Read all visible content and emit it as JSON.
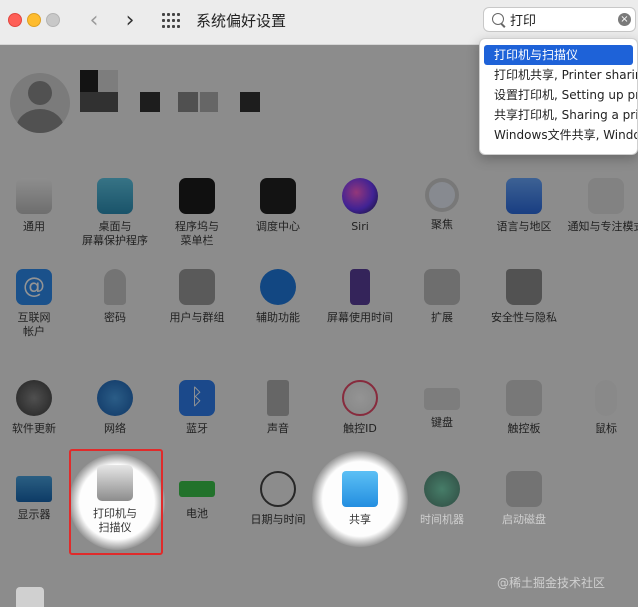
{
  "window": {
    "title": "系统偏好设置"
  },
  "search": {
    "value": "打印"
  },
  "dropdown": {
    "items": [
      "打印机与扫描仪",
      "打印机共享, Printer sharing",
      "设置打印机, Setting up printers",
      "共享打印机, Sharing a printer",
      "Windows文件共享, Windows file sharing"
    ]
  },
  "prefs": {
    "row1": [
      {
        "label": "通用"
      },
      {
        "label": "桌面与\n屏幕保护程序"
      },
      {
        "label": "程序坞与\n菜单栏"
      },
      {
        "label": "调度中心"
      },
      {
        "label": "Siri"
      },
      {
        "label": "聚焦"
      },
      {
        "label": "语言与地区"
      },
      {
        "label": "通知与专注模式"
      }
    ],
    "row2": [
      {
        "label": "互联网\n帐户"
      },
      {
        "label": "密码"
      },
      {
        "label": "用户与群组"
      },
      {
        "label": "辅助功能"
      },
      {
        "label": "屏幕使用时间"
      },
      {
        "label": "扩展"
      },
      {
        "label": "安全性与隐私"
      }
    ],
    "row3": [
      {
        "label": "软件更新"
      },
      {
        "label": "网络"
      },
      {
        "label": "蓝牙"
      },
      {
        "label": "声音"
      },
      {
        "label": "触控ID"
      },
      {
        "label": "键盘"
      },
      {
        "label": "触控板"
      },
      {
        "label": "鼠标"
      }
    ],
    "row4": [
      {
        "label": "显示器"
      },
      {
        "label": "打印机与\n扫描仪"
      },
      {
        "label": "电池"
      },
      {
        "label": "日期与时间"
      },
      {
        "label": "共享"
      },
      {
        "label": "时间机器"
      },
      {
        "label": "启动磁盘"
      }
    ]
  },
  "watermark": "@稀土掘金技术社区",
  "colors": {
    "accent": "#1e62d8",
    "highlight_border": "#e02b2b"
  }
}
